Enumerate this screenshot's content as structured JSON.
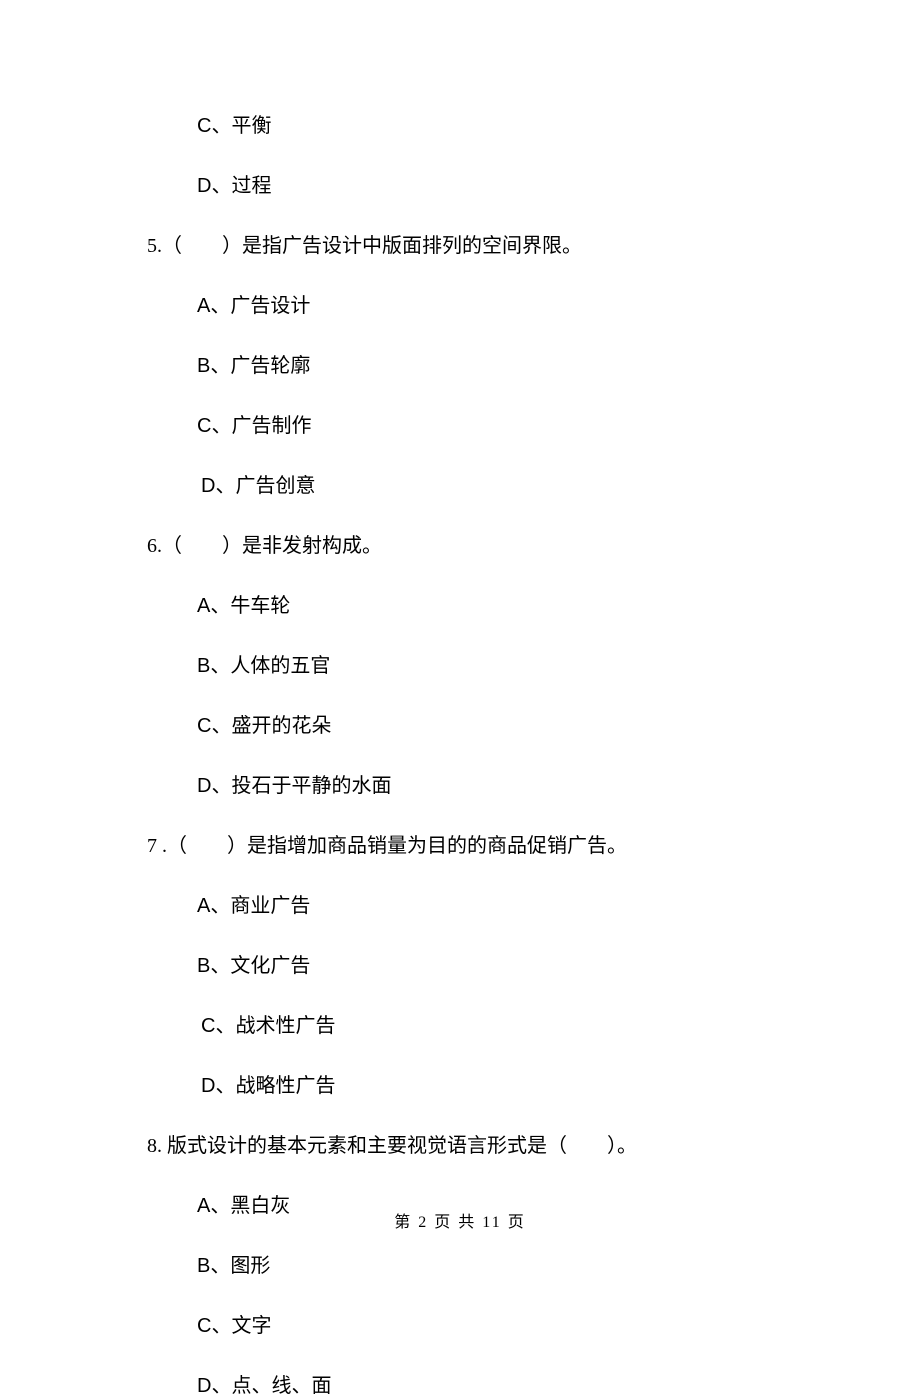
{
  "q4_tail_options": [
    {
      "letter": "C",
      "text": "、平衡"
    },
    {
      "letter": "D",
      "text": "、过程"
    }
  ],
  "q5": {
    "num": "5.",
    "stem": "（　　）是指广告设计中版面排列的空间界限。",
    "options": [
      {
        "letter": "A",
        "text": "、广告设计"
      },
      {
        "letter": "B",
        "text": "、广告轮廓"
      },
      {
        "letter": "C",
        "text": "、广告制作"
      },
      {
        "letter": "D",
        "text": "、广告创意",
        "extra_indent": true
      }
    ]
  },
  "q6": {
    "num": "6.",
    "stem": "（　　）是非发射构成。",
    "options": [
      {
        "letter": "A",
        "text": "、牛车轮"
      },
      {
        "letter": "B",
        "text": "、人体的五官"
      },
      {
        "letter": "C",
        "text": "、盛开的花朵"
      },
      {
        "letter": "D",
        "text": "、投石于平静的水面"
      }
    ]
  },
  "q7": {
    "num": "7 .",
    "stem": "（　　）是指增加商品销量为目的的商品促销广告。",
    "options": [
      {
        "letter": "A",
        "text": "、商业广告"
      },
      {
        "letter": "B",
        "text": "、文化广告"
      },
      {
        "letter": "C",
        "text": "、战术性广告",
        "extra_indent": true
      },
      {
        "letter": "D",
        "text": "、战略性广告",
        "extra_indent": true
      }
    ]
  },
  "q8": {
    "num": "8.",
    "stem_prefix": " 版式设计的基本元素和主要视觉语言形式是（　　）。",
    "options": [
      {
        "letter": "A",
        "text": "、黑白灰"
      },
      {
        "letter": "B",
        "text": "、图形"
      },
      {
        "letter": "C",
        "text": "、文字"
      },
      {
        "letter": "D",
        "text": "、点、线、面"
      }
    ]
  },
  "footer": "第 2 页 共 11 页"
}
